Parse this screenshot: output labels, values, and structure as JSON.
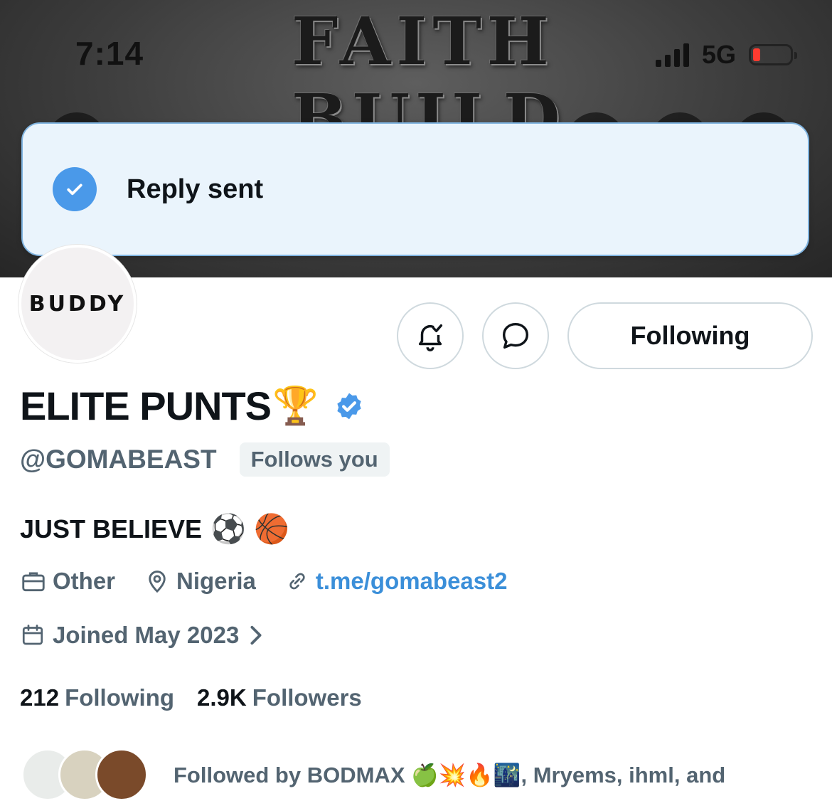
{
  "banner": {
    "line1": "FAITH",
    "line2": "BUILD"
  },
  "status_bar": {
    "time": "7:14",
    "network": "5G",
    "battery_color": "#ff3b30"
  },
  "toast": {
    "message": "Reply sent",
    "icon": "check-circle-icon",
    "accent": "#4a99e9"
  },
  "profile": {
    "avatar_text": "BUDDY",
    "display_name": "ELITE PUNTS",
    "name_emoji": "🏆",
    "handle": "@GOMABEAST",
    "follows_badge": "Follows you",
    "bio_text": "JUST BELIEVE",
    "bio_emoji": "⚽ 🏀",
    "category": "Other",
    "location": "Nigeria",
    "link": "t.me/gomabeast2",
    "joined": "Joined May 2023",
    "following_count": "212",
    "following_label": "Following",
    "followers_count": "2.9K",
    "followers_label": "Followers",
    "followed_by": "Followed by BODMAX 🍏💥🔥🌃, Mryems, ihml, and"
  },
  "actions": {
    "notify_icon": "bell-check-icon",
    "message_icon": "message-bubble-icon",
    "following_button": "Following"
  },
  "colors": {
    "secondary_text": "#536471",
    "link": "#3b8fd9",
    "verified": "#4a99e9",
    "border": "#cfd9de"
  }
}
